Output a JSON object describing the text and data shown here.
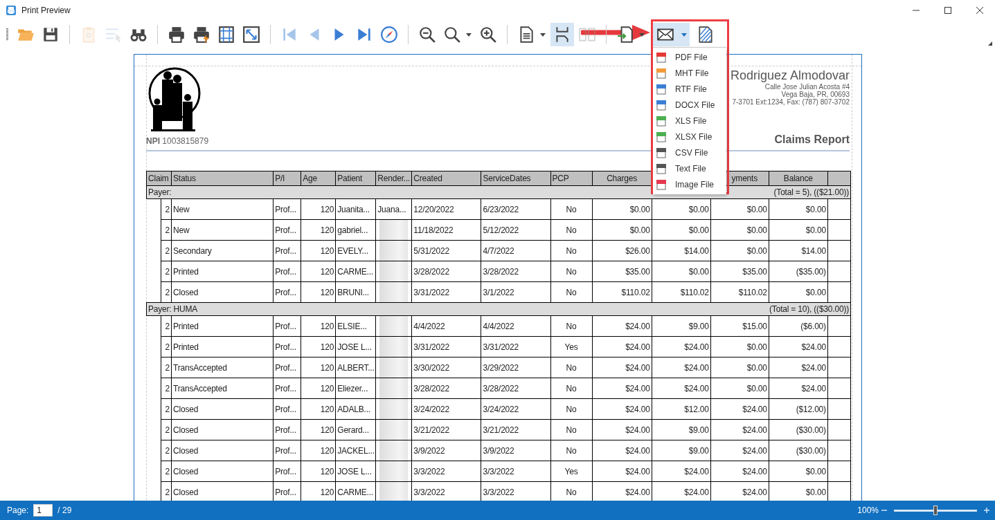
{
  "window": {
    "title": "Print Preview"
  },
  "toolbar": [
    {
      "kind": "open",
      "disabled": false,
      "pressed": false
    },
    {
      "kind": "save",
      "disabled": false,
      "pressed": false
    },
    {
      "kind": "separator"
    },
    {
      "kind": "parameters",
      "disabled": true,
      "pressed": false
    },
    {
      "kind": "editing-fields",
      "disabled": true,
      "pressed": false
    },
    {
      "kind": "find",
      "disabled": false,
      "pressed": false
    },
    {
      "kind": "separator"
    },
    {
      "kind": "print",
      "disabled": false,
      "pressed": false
    },
    {
      "kind": "quick-print",
      "disabled": false,
      "pressed": false
    },
    {
      "kind": "page-setup",
      "disabled": false,
      "pressed": false
    },
    {
      "kind": "scale",
      "disabled": false,
      "pressed": false
    },
    {
      "kind": "separator"
    },
    {
      "kind": "first",
      "disabled": true,
      "pressed": false
    },
    {
      "kind": "prev",
      "disabled": true,
      "pressed": false
    },
    {
      "kind": "next",
      "disabled": false,
      "pressed": false
    },
    {
      "kind": "last",
      "disabled": false,
      "pressed": false
    },
    {
      "kind": "navigate",
      "disabled": false,
      "pressed": false
    },
    {
      "kind": "separator"
    },
    {
      "kind": "zoom-out",
      "disabled": false,
      "pressed": false
    },
    {
      "kind": "zoom",
      "disabled": false,
      "pressed": false,
      "dropdown": true
    },
    {
      "kind": "zoom-in",
      "disabled": false,
      "pressed": false
    },
    {
      "kind": "separator"
    },
    {
      "kind": "document",
      "disabled": false,
      "pressed": false,
      "dropdown": true
    },
    {
      "kind": "multipage",
      "disabled": false,
      "pressed": true
    },
    {
      "kind": "two-page",
      "disabled": true,
      "pressed": false
    },
    {
      "kind": "separator"
    },
    {
      "kind": "export",
      "disabled": false,
      "pressed": false,
      "dropdown": true
    }
  ],
  "send_group": {
    "email": {
      "pressed": true,
      "dropdown": true
    },
    "watermark": {
      "disabled": false
    },
    "menu": {
      "expanded": true,
      "items": [
        {
          "label": "PDF File",
          "color": "#e53935"
        },
        {
          "label": "MHT File",
          "color": "#f39c3c"
        },
        {
          "label": "RTF File",
          "color": "#3b7fd4"
        },
        {
          "label": "DOCX File",
          "color": "#3b7fd4"
        },
        {
          "label": "XLS File",
          "color": "#4caf50"
        },
        {
          "label": "XLSX File",
          "color": "#4caf50"
        },
        {
          "label": "CSV File",
          "color": "#555555"
        },
        {
          "label": "Text File",
          "color": "#555555"
        },
        {
          "label": "Image File",
          "color": "#e53950"
        }
      ]
    }
  },
  "report": {
    "company": "Rodriguez Almodovar",
    "address_lines": [
      "Calle Jose Julian Acosta #4",
      "Vega Baja, PR, 00693",
      "7-3701 Ext:1234, Fax: (787) 807-3702"
    ],
    "npi_label": "NPI",
    "npi": "1003815879",
    "title": "Claims Report",
    "columns": [
      {
        "label": "Claim"
      },
      {
        "label": "Status"
      },
      {
        "label": "P/I"
      },
      {
        "label": "Age"
      },
      {
        "label": "Patient"
      },
      {
        "label": "Render..."
      },
      {
        "label": "Created"
      },
      {
        "label": "ServiceDates"
      },
      {
        "label": "PCP"
      },
      {
        "label": "Charges"
      },
      {},
      {
        "label": "yments"
      },
      {
        "label": "Balance"
      },
      {}
    ],
    "groups": [
      {
        "payer": "Payer:",
        "total": "(Total = 5), (($21.00))",
        "rows": [
          {
            "claim": "2",
            "status": "New",
            "pi": "Prof...",
            "age": "120",
            "patient": "Juanita...",
            "render": "Juana...",
            "render_redacted": false,
            "created": "12/20/2022",
            "service_dates": "6/23/2022",
            "pcp": "No",
            "charges": "$0.00",
            "column_11": "$0.00",
            "payments": "$0.00",
            "balance": "$0.00"
          },
          {
            "claim": "2",
            "status": "New",
            "pi": "Prof...",
            "age": "120",
            "patient": "gabriel...",
            "render_redacted": true,
            "created": "11/18/2022",
            "service_dates": "5/12/2022",
            "pcp": "No",
            "charges": "$0.00",
            "column_11": "$0.00",
            "payments": "$0.00",
            "balance": "$0.00"
          },
          {
            "claim": "2",
            "status": "Secondary",
            "pi": "Prof...",
            "age": "120",
            "patient": "EVELY...",
            "render_redacted": true,
            "created": "5/31/2022",
            "service_dates": "4/7/2022",
            "pcp": "No",
            "charges": "$26.00",
            "column_11": "$14.00",
            "payments": "$0.00",
            "balance": "$14.00"
          },
          {
            "claim": "2",
            "status": "Printed",
            "pi": "Prof...",
            "age": "120",
            "patient": "CARME...",
            "render_redacted": true,
            "created": "3/28/2022",
            "service_dates": "3/28/2022",
            "pcp": "No",
            "charges": "$35.00",
            "column_11": "$0.00",
            "payments": "$35.00",
            "balance": "($35.00)"
          },
          {
            "claim": "2",
            "status": "Closed",
            "pi": "Prof...",
            "age": "120",
            "patient": "BRUNI...",
            "render_redacted": true,
            "created": "3/31/2022",
            "service_dates": "3/1/2022",
            "pcp": "No",
            "charges": "$110.02",
            "column_11": "$110.02",
            "payments": "$110.02",
            "balance": "$0.00"
          }
        ]
      },
      {
        "payer": "Payer: HUMA",
        "total": "(Total = 10), (($30.00))",
        "rows": [
          {
            "claim": "2",
            "status": "Printed",
            "pi": "Prof...",
            "age": "120",
            "patient": "ELSIE...",
            "render_redacted": true,
            "created": "4/4/2022",
            "service_dates": "4/4/2022",
            "pcp": "No",
            "charges": "$24.00",
            "column_11": "$9.00",
            "payments": "$15.00",
            "balance": "($6.00)"
          },
          {
            "claim": "2",
            "status": "Printed",
            "pi": "Prof...",
            "age": "120",
            "patient": "JOSE L...",
            "render_redacted": true,
            "created": "3/31/2022",
            "service_dates": "3/31/2022",
            "pcp": "Yes",
            "charges": "$24.00",
            "column_11": "$24.00",
            "payments": "$0.00",
            "balance": "$24.00"
          },
          {
            "claim": "2",
            "status": "TransAccepted",
            "pi": "Prof...",
            "age": "120",
            "patient": "ALBERT...",
            "render_redacted": true,
            "created": "3/30/2022",
            "service_dates": "3/29/2022",
            "pcp": "No",
            "charges": "$24.00",
            "column_11": "$24.00",
            "payments": "$0.00",
            "balance": "$24.00"
          },
          {
            "claim": "2",
            "status": "TransAccepted",
            "pi": "Prof...",
            "age": "120",
            "patient": "Eliezer...",
            "render_redacted": true,
            "created": "3/28/2022",
            "service_dates": "3/28/2022",
            "pcp": "No",
            "charges": "$24.00",
            "column_11": "$24.00",
            "payments": "$0.00",
            "balance": "$24.00"
          },
          {
            "claim": "2",
            "status": "Closed",
            "pi": "Prof...",
            "age": "120",
            "patient": "ADALB...",
            "render_redacted": true,
            "created": "3/24/2022",
            "service_dates": "3/24/2022",
            "pcp": "No",
            "charges": "$24.00",
            "column_11": "$12.00",
            "payments": "$24.00",
            "balance": "($12.00)"
          },
          {
            "claim": "2",
            "status": "Closed",
            "pi": "Prof...",
            "age": "120",
            "patient": "Gerard...",
            "render_redacted": true,
            "created": "3/21/2022",
            "service_dates": "3/21/2022",
            "pcp": "No",
            "charges": "$24.00",
            "column_11": "$9.00",
            "payments": "$24.00",
            "balance": "($30.00)"
          },
          {
            "claim": "2",
            "status": "Closed",
            "pi": "Prof...",
            "age": "120",
            "patient": "JACKEL...",
            "render_redacted": true,
            "created": "3/9/2022",
            "service_dates": "3/9/2022",
            "pcp": "No",
            "charges": "$24.00",
            "column_11": "$9.00",
            "payments": "$24.00",
            "balance": "($30.00)"
          },
          {
            "claim": "2",
            "status": "Closed",
            "pi": "Prof...",
            "age": "120",
            "patient": "JOSE L...",
            "render_redacted": true,
            "created": "3/3/2022",
            "service_dates": "3/3/2022",
            "pcp": "Yes",
            "charges": "$24.00",
            "column_11": "$24.00",
            "payments": "$24.00",
            "balance": "$0.00"
          },
          {
            "claim": "2",
            "status": "Closed",
            "pi": "Prof...",
            "age": "120",
            "patient": "CARME...",
            "render_redacted": true,
            "created": "3/3/2022",
            "service_dates": "3/3/2022",
            "pcp": "No",
            "charges": "$24.00",
            "column_11": "$24.00",
            "payments": "$24.00",
            "balance": "$0.00"
          }
        ]
      }
    ]
  },
  "status_bar": {
    "page_label": "Page:",
    "page_value": "1",
    "page_count": "/ 29",
    "zoom": "100%",
    "zoom_slider": {
      "level": 0.5
    }
  }
}
